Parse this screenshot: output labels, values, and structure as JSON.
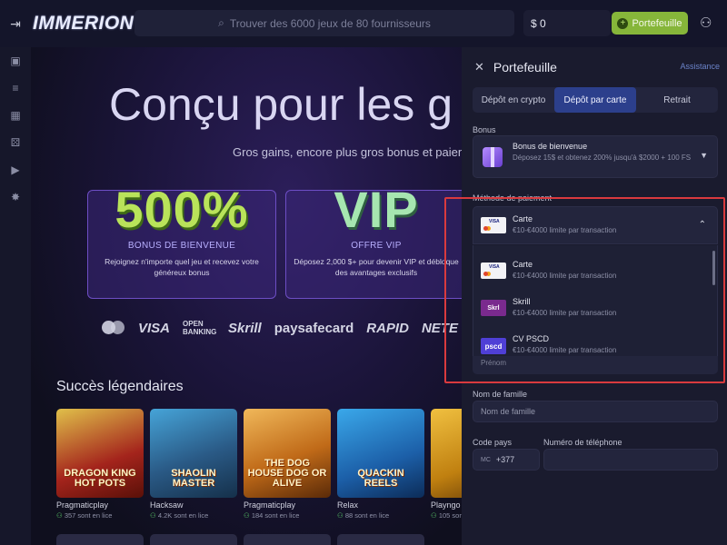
{
  "header": {
    "logo": "IMMERION",
    "search_placeholder": "Trouver des 6000 jeux de 80 fournisseurs",
    "balance": "$ 0",
    "wallet_button": "Portefeuille"
  },
  "hero": {
    "title": "Conçu pour les g",
    "subtitle": "Gros gains, encore plus gros bonus et paiem"
  },
  "promos": [
    {
      "big": "500%",
      "title": "BONUS DE BIENVENUE",
      "desc": "Rejoignez n'importe quel jeu et recevez votre généreux bonus"
    },
    {
      "big": "VIP",
      "title": "OFFRE VIP",
      "desc": "Déposez 2,000 $+ pour devenir VIP et débloque des avantages exclusifs"
    }
  ],
  "payment_logos": [
    "VISA",
    "OPEN BANKING",
    "Skrill",
    "paysafecard",
    "RAPID",
    "NETE"
  ],
  "section": {
    "title": "Succès légendaires"
  },
  "games": [
    {
      "name": "DRAGON KING HOT POTS",
      "provider": "Pragmaticplay",
      "players": "357 sont en lice"
    },
    {
      "name": "SHAOLIN MASTER",
      "provider": "Hacksaw",
      "players": "4.2K sont en lice"
    },
    {
      "name": "THE DOG HOUSE DOG OR ALIVE",
      "provider": "Pragmaticplay",
      "players": "184 sont en lice"
    },
    {
      "name": "QUACKIN REELS",
      "provider": "Relax",
      "players": "88 sont en lice"
    },
    {
      "name": "",
      "provider": "Playngo",
      "players": "105 sont"
    }
  ],
  "wallet": {
    "title": "Portefeuille",
    "assistance": "Assistance",
    "tabs": [
      "Dépôt en crypto",
      "Dépôt par carte",
      "Retrait"
    ],
    "bonus_label": "Bonus",
    "bonus_title": "Bonus de bienvenue",
    "bonus_desc": "Déposez 15$ et obtenez 200% jusqu'à $2000 + 100 FS",
    "method_label": "Méthode de paiement",
    "selected": {
      "name": "Carte",
      "limit": "€10-€4000 limite par transaction"
    },
    "options": [
      {
        "name": "Carte",
        "limit": "€10-€4000 limite par transaction",
        "logo": "visa-mastercard"
      },
      {
        "name": "Skrill",
        "limit": "€10-€4000 limite par transaction",
        "logo": "Skrl"
      },
      {
        "name": "CV PSCD",
        "limit": "€10-€4000 limite par transaction",
        "logo": "pscd"
      }
    ],
    "first_name_placeholder": "Prénom",
    "last_name_label": "Nom de famille",
    "last_name_placeholder": "Nom de famille",
    "country_code_label": "Code pays",
    "phone_label": "Numéro de téléphone",
    "country_prefix": "MC",
    "country_code": "+377"
  }
}
